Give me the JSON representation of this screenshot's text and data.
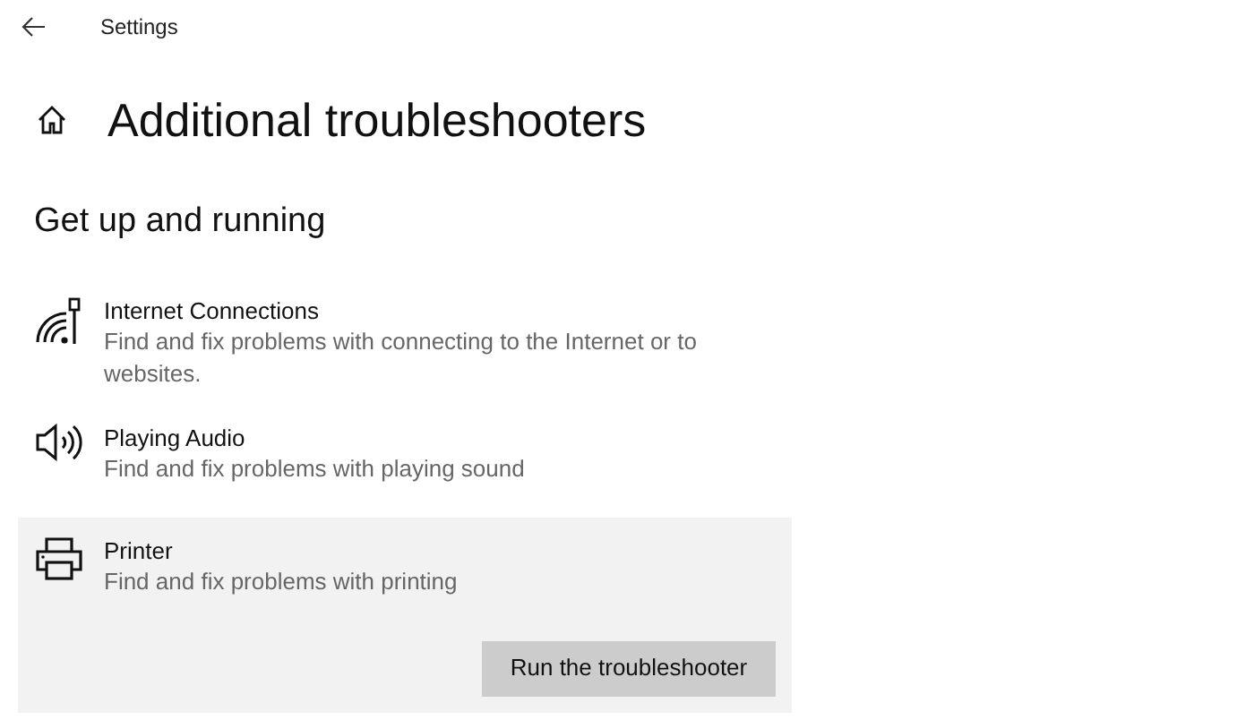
{
  "window": {
    "title": "Settings"
  },
  "page": {
    "title": "Additional troubleshooters"
  },
  "section": {
    "title": "Get up and running"
  },
  "items": [
    {
      "kind": "network",
      "title": "Internet Connections",
      "description": "Find and fix problems with connecting to the Internet or to websites.",
      "selected": false
    },
    {
      "kind": "audio",
      "title": "Playing Audio",
      "description": "Find and fix problems with playing sound",
      "selected": false
    },
    {
      "kind": "printer",
      "title": "Printer",
      "description": "Find and fix problems with printing",
      "selected": true,
      "action": "Run the troubleshooter"
    }
  ]
}
